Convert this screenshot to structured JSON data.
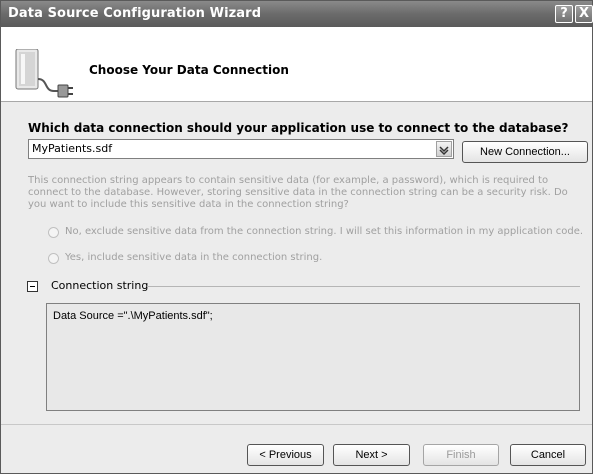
{
  "window": {
    "title": "Data Source Configuration Wizard",
    "help_label": "?",
    "close_label": "X"
  },
  "header": {
    "title": "Choose Your Data Connection",
    "icon": "database-icon"
  },
  "connection": {
    "question": "Which data connection should your application use to connect to the database?",
    "selected": "MyPatients.sdf",
    "new_connection_label": "New Connection..."
  },
  "sensitive": {
    "warning": "This connection string appears to contain sensitive data (for example, a password), which is required to connect to the database. However, storing sensitive data in the connection string can be a security risk. Do you want to include this sensitive data in the connection string?",
    "option_no": "No, exclude sensitive data from the connection string. I will set this information in my application code.",
    "option_yes": "Yes, include sensitive data in the connection string."
  },
  "connection_string": {
    "label": "Connection string",
    "value": "Data Source =\".\\MyPatients.sdf\";"
  },
  "footer": {
    "previous_label": "< Previous",
    "next_label": "Next >",
    "finish_label": "Finish",
    "cancel_label": "Cancel"
  }
}
